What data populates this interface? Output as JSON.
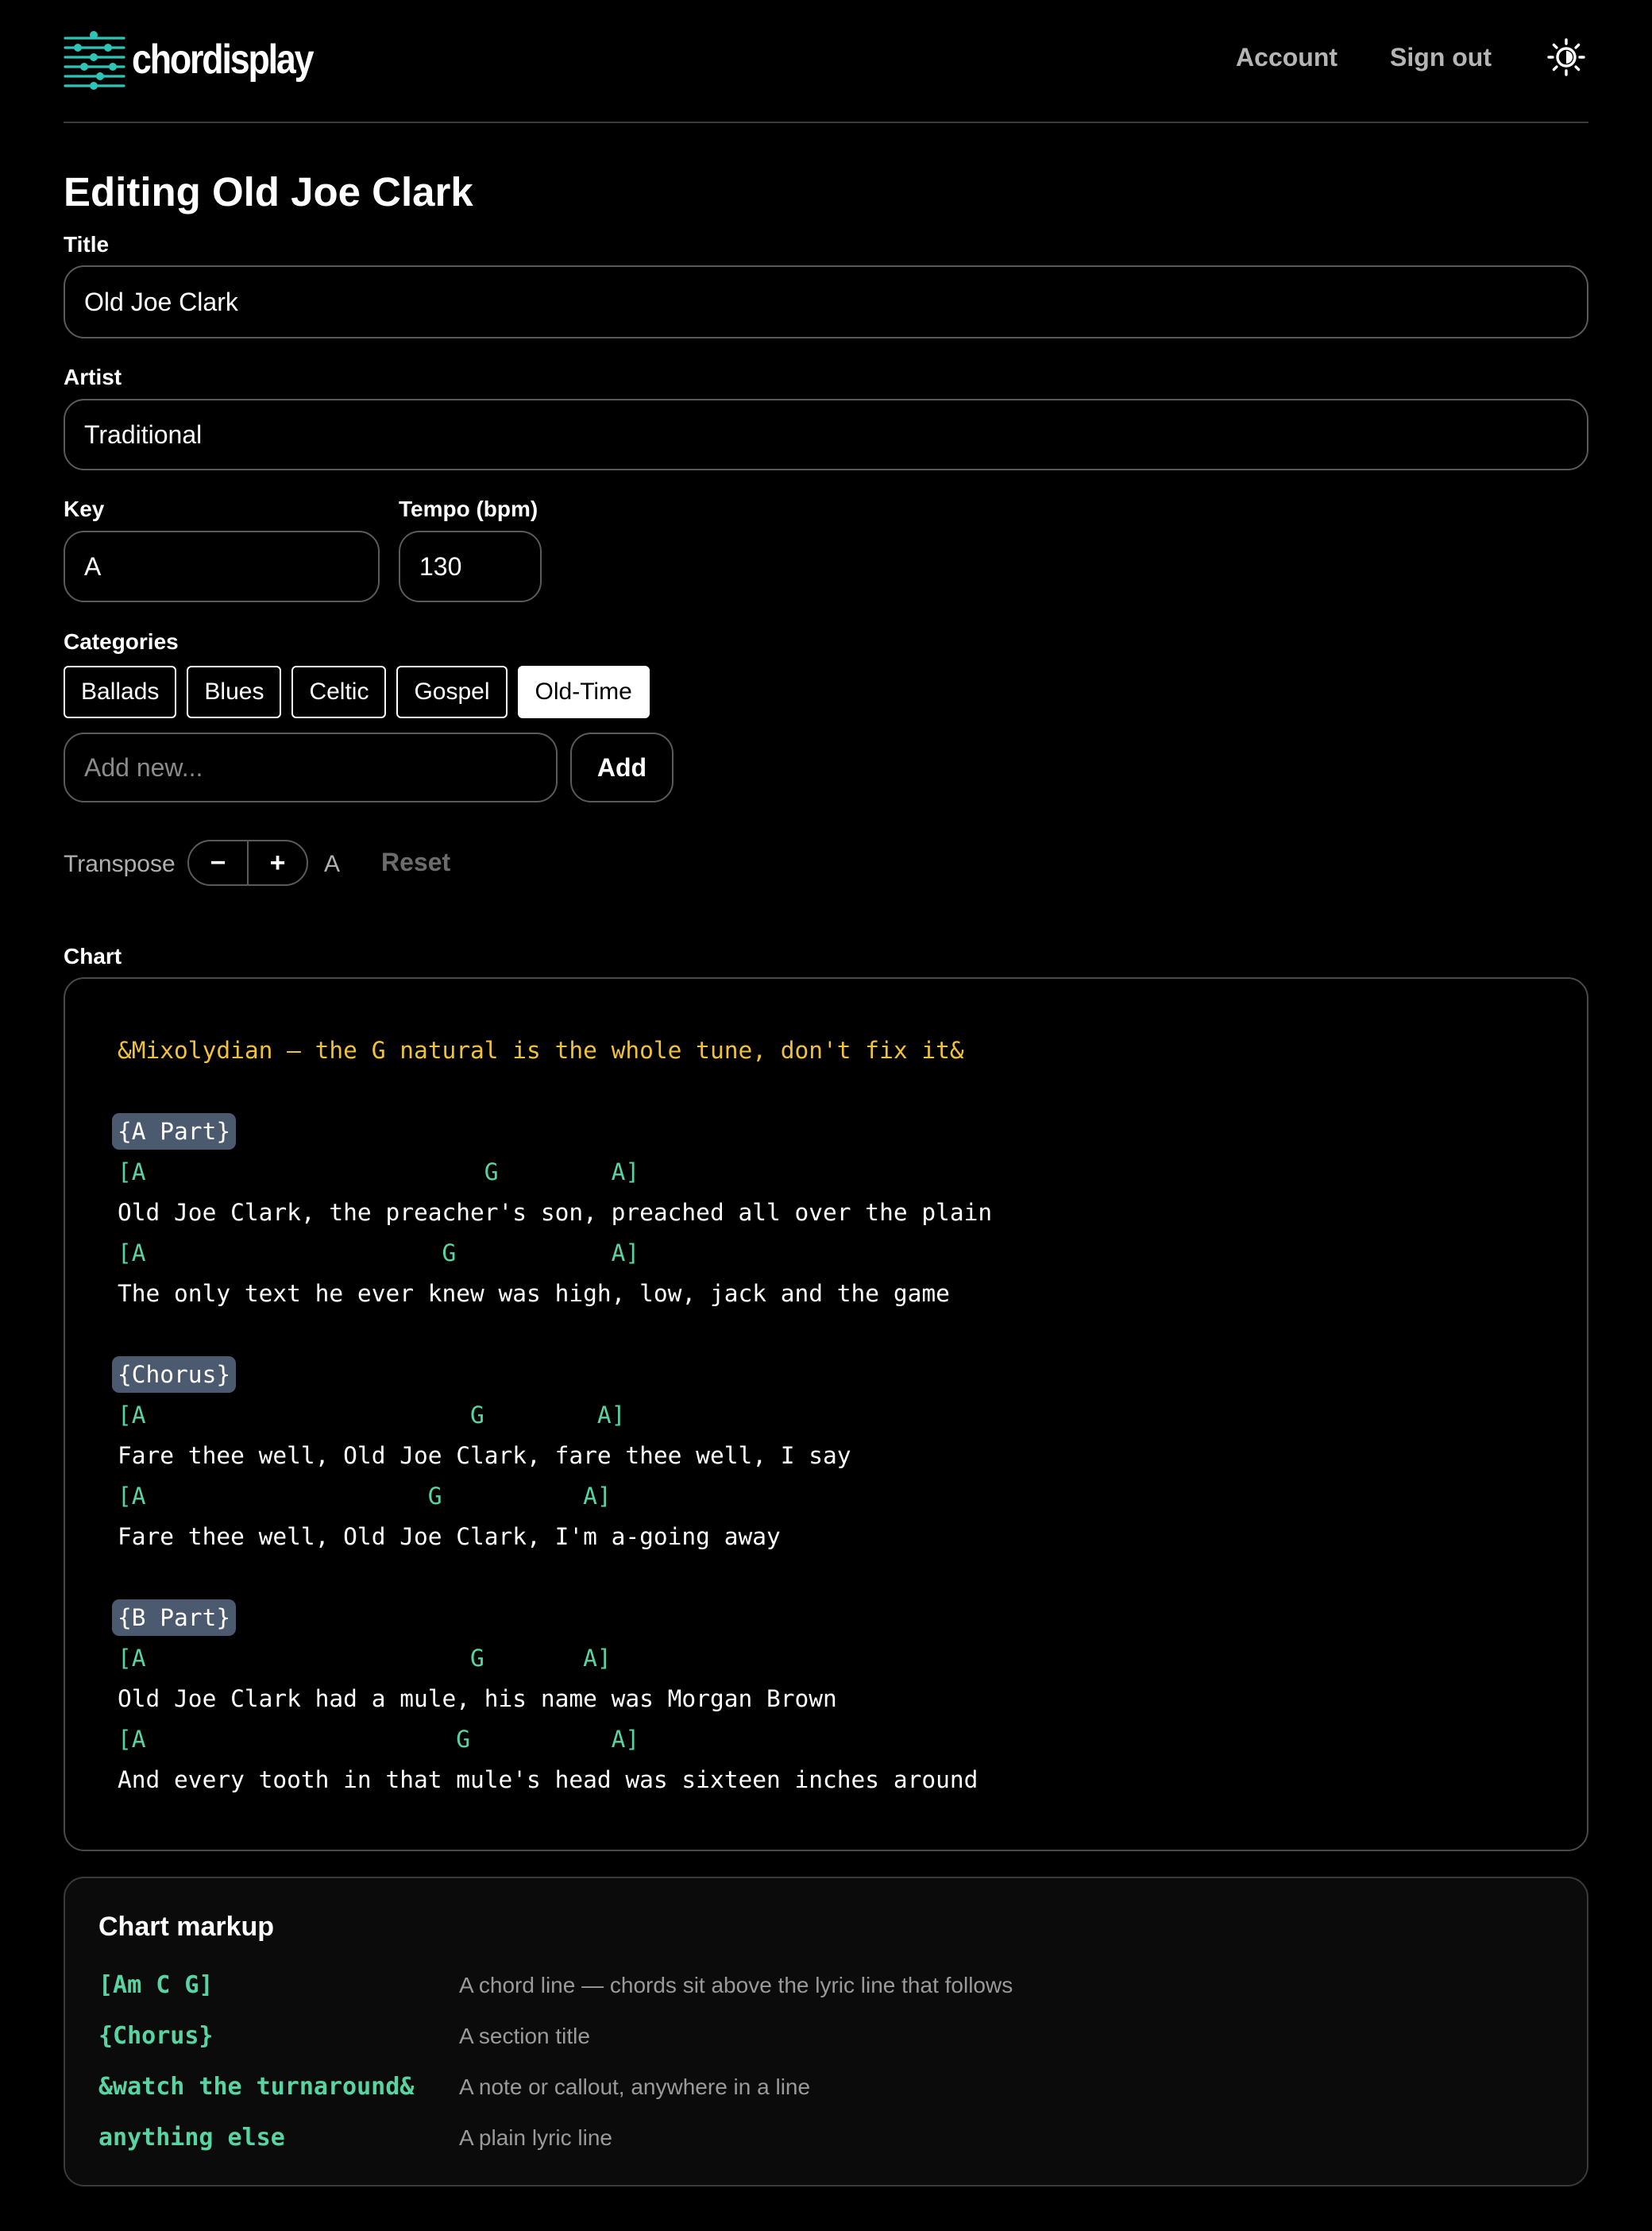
{
  "header": {
    "logo_text": "chordisplay",
    "nav": {
      "account": "Account",
      "sign_out": "Sign out"
    },
    "theme_icon": "sun-icon"
  },
  "page_title": "Editing Old Joe Clark",
  "form": {
    "title_label": "Title",
    "title_value": "Old Joe Clark",
    "artist_label": "Artist",
    "artist_value": "Traditional",
    "key_label": "Key",
    "key_value": "A",
    "tempo_label": "Tempo (bpm)",
    "tempo_value": "130",
    "categories_label": "Categories",
    "categories": [
      {
        "label": "Ballads",
        "selected": false
      },
      {
        "label": "Blues",
        "selected": false
      },
      {
        "label": "Celtic",
        "selected": false
      },
      {
        "label": "Gospel",
        "selected": false
      },
      {
        "label": "Old-Time",
        "selected": true
      }
    ],
    "add_placeholder": "Add new...",
    "add_button": "Add"
  },
  "transpose": {
    "label": "Transpose",
    "minus": "−",
    "plus": "+",
    "current_key": "A",
    "reset": "Reset"
  },
  "chart": {
    "label": "Chart",
    "lines": [
      {
        "type": "note",
        "text": "&Mixolydian — the G natural is the whole tune, don't fix it&"
      },
      {
        "type": "blank",
        "text": ""
      },
      {
        "type": "section",
        "text": "{A Part}"
      },
      {
        "type": "chord",
        "text": "[A                        G        A]"
      },
      {
        "type": "lyric",
        "text": "Old Joe Clark, the preacher's son, preached all over the plain"
      },
      {
        "type": "chord",
        "text": "[A                     G           A]"
      },
      {
        "type": "lyric",
        "text": "The only text he ever knew was high, low, jack and the game"
      },
      {
        "type": "blank",
        "text": ""
      },
      {
        "type": "section",
        "text": "{Chorus}"
      },
      {
        "type": "chord",
        "text": "[A                       G        A]"
      },
      {
        "type": "lyric",
        "text": "Fare thee well, Old Joe Clark, fare thee well, I say"
      },
      {
        "type": "chord",
        "text": "[A                    G          A]"
      },
      {
        "type": "lyric",
        "text": "Fare thee well, Old Joe Clark, I'm a-going away"
      },
      {
        "type": "blank",
        "text": ""
      },
      {
        "type": "section",
        "text": "{B Part}"
      },
      {
        "type": "chord",
        "text": "[A                       G       A]"
      },
      {
        "type": "lyric",
        "text": "Old Joe Clark had a mule, his name was Morgan Brown"
      },
      {
        "type": "chord",
        "text": "[A                      G          A]"
      },
      {
        "type": "lyric",
        "text": "And every tooth in that mule's head was sixteen inches around"
      }
    ]
  },
  "markup_reference": {
    "title": "Chart markup",
    "rows": [
      {
        "code": "[Am C G]",
        "desc": "A chord line — chords sit above the lyric line that follows"
      },
      {
        "code": "{Chorus}",
        "desc": "A section title"
      },
      {
        "code": "&watch the turnaround&",
        "desc": "A note or callout, anywhere in a line"
      },
      {
        "code": "anything else",
        "desc": "A plain lyric line"
      }
    ]
  },
  "colors": {
    "background": "#000000",
    "chord": "#58d3a2",
    "note": "#f0c23a",
    "section_bg": "#4b5a6e",
    "logo_accent": "#2ec4b6"
  }
}
